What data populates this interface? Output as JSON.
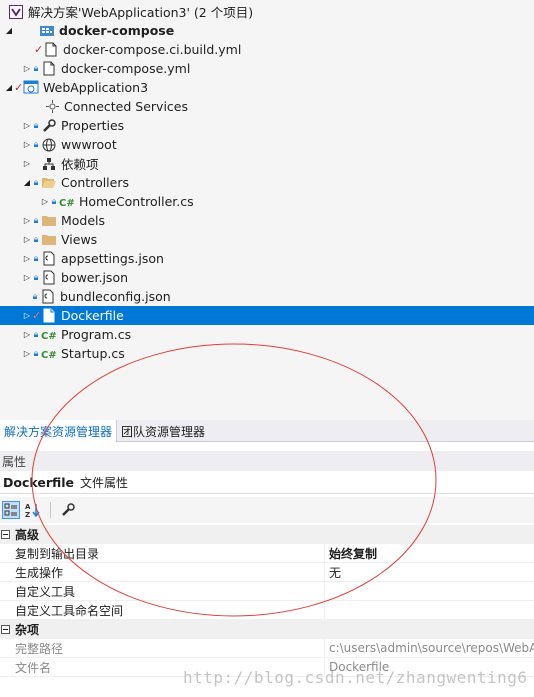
{
  "solution_explorer": {
    "solution_label": "解决方案'WebApplication3' (2 个项目)",
    "items": [
      {
        "label": "docker-compose",
        "bold": true
      },
      {
        "label": "docker-compose.ci.build.yml"
      },
      {
        "label": "docker-compose.yml"
      },
      {
        "label": "WebApplication3"
      },
      {
        "label": "Connected Services"
      },
      {
        "label": "Properties"
      },
      {
        "label": "wwwroot"
      },
      {
        "label": "依赖项"
      },
      {
        "label": "Controllers"
      },
      {
        "label": "HomeController.cs"
      },
      {
        "label": "Models"
      },
      {
        "label": "Views"
      },
      {
        "label": "appsettings.json"
      },
      {
        "label": "bower.json"
      },
      {
        "label": "bundleconfig.json"
      },
      {
        "label": "Dockerfile",
        "selected": true
      },
      {
        "label": "Program.cs"
      },
      {
        "label": "Startup.cs"
      }
    ]
  },
  "tabs": [
    {
      "label": "解决方案资源管理器",
      "active": true
    },
    {
      "label": "团队资源管理器",
      "active": false
    }
  ],
  "properties": {
    "title": "属性",
    "object_name": "Dockerfile",
    "object_type": "文件属性",
    "categories": [
      {
        "name": "高级",
        "rows": [
          {
            "name": "复制到输出目录",
            "value": "始终复制",
            "bold": true
          },
          {
            "name": "生成操作",
            "value": "无"
          },
          {
            "name": "自定义工具",
            "value": ""
          },
          {
            "name": "自定义工具命名空间",
            "value": ""
          }
        ]
      },
      {
        "name": "杂项",
        "rows": [
          {
            "name": "完整路径",
            "value": "c:\\users\\admin\\source\\repos\\WebA",
            "readonly": true
          },
          {
            "name": "文件名",
            "value": "Dockerfile",
            "readonly": true
          }
        ]
      }
    ]
  },
  "watermark": "http://blog.csdn.net/zhangwenting6",
  "colors": {
    "selection": "#0078d7",
    "accent_tab": "#0e70c0",
    "annotation_ellipse": "#e0403a"
  }
}
